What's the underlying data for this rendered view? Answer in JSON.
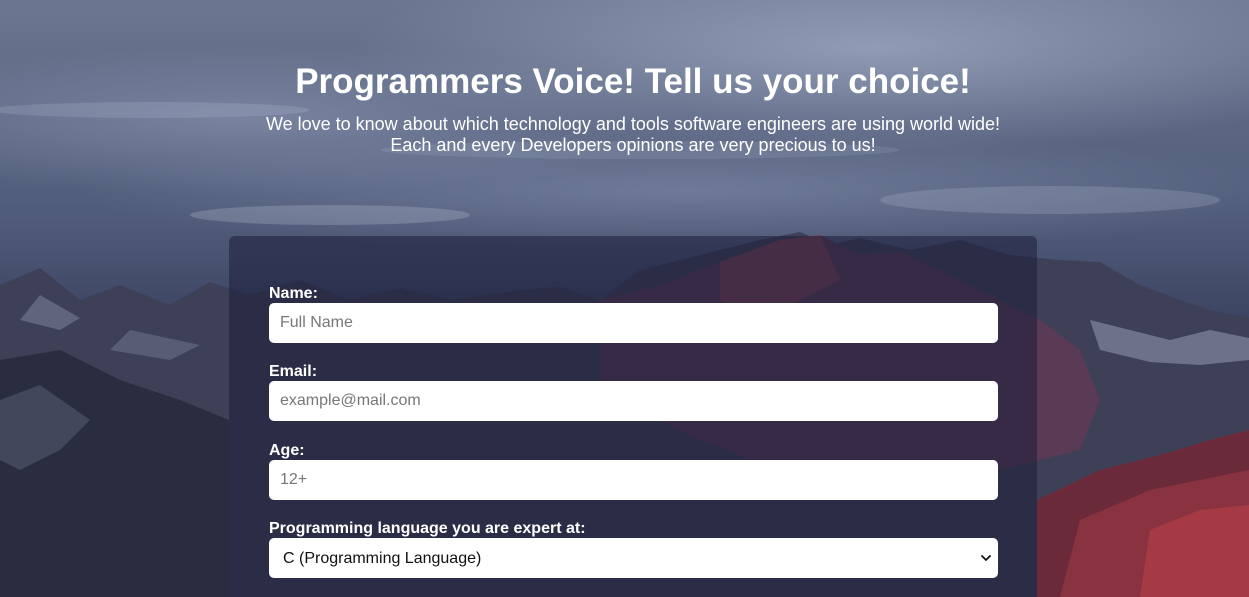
{
  "header": {
    "title": "Programmers Voice! Tell us your choice!",
    "description_line1": "We love to know about which technology and tools software engineers are using world wide!",
    "description_line2": "Each and every Developers opinions are very precious to us!"
  },
  "form": {
    "name": {
      "label": "Name:",
      "placeholder": "Full Name",
      "value": ""
    },
    "email": {
      "label": "Email:",
      "placeholder": "example@mail.com",
      "value": ""
    },
    "age": {
      "label": "Age:",
      "placeholder": "12+",
      "value": ""
    },
    "language": {
      "label": "Programming language you are expert at:",
      "selected": "C (Programming Language)",
      "icon": "chevron-down-icon"
    }
  },
  "colors": {
    "text": "#ffffff",
    "panel": "#1c1e3a",
    "input_bg": "#ffffff"
  }
}
